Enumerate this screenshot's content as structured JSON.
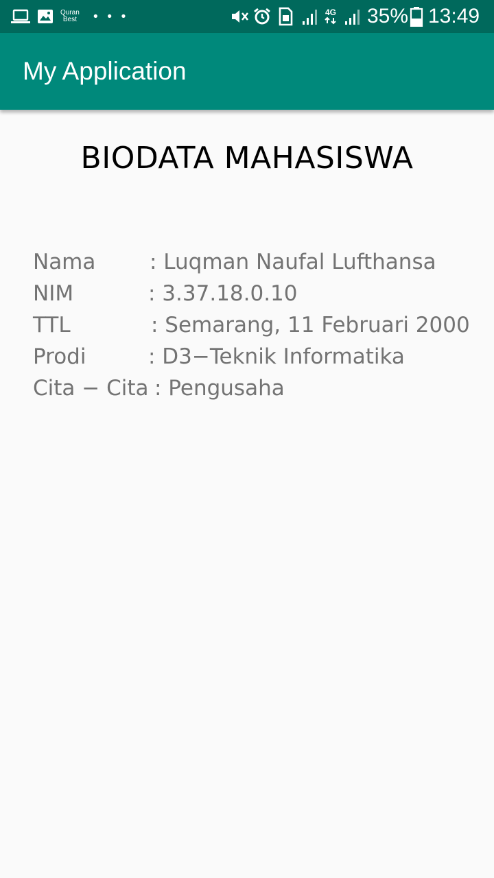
{
  "status_bar": {
    "left_icons": [
      "laptop-icon",
      "image-icon",
      "quran-best-icon",
      "more-dots-icon"
    ],
    "quran_line1": "Quran",
    "quran_line2": "Best",
    "dots": "• • •",
    "right_icons": [
      "mute-icon",
      "alarm-icon",
      "sim-icon",
      "signal-icon",
      "4g-icon",
      "signal-icon",
      "battery-icon"
    ],
    "network_label": "4G",
    "battery_percent": "35%",
    "time": "13:49"
  },
  "app_bar": {
    "title": "My Application",
    "color": "#00897b",
    "status_color": "#00695c"
  },
  "content": {
    "heading": "BIODATA MAHASISWA",
    "rows": [
      {
        "label": "Nama",
        "value": ": Luqman Naufal Lufthansa"
      },
      {
        "label": "NIM",
        "value": ": 3.37.18.0.10"
      },
      {
        "label": "TTL",
        "value": ": Semarang, 11 Februari 2000"
      },
      {
        "label": "Prodi",
        "value": ": D3−Teknik Informatika"
      },
      {
        "label": "Cita − Cita",
        "value": ": Pengusaha"
      }
    ]
  }
}
